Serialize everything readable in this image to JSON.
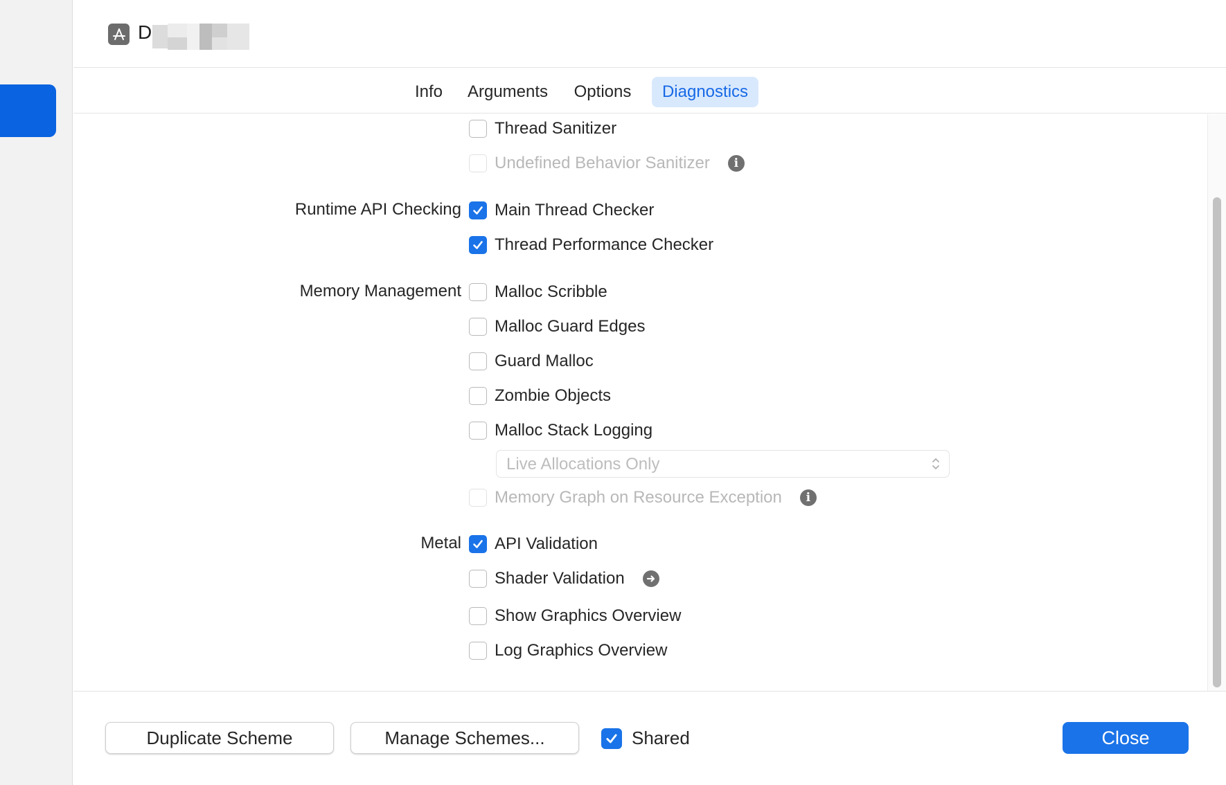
{
  "header": {
    "scheme_name": "D"
  },
  "tabs": [
    {
      "label": "Info",
      "active": false
    },
    {
      "label": "Arguments",
      "active": false
    },
    {
      "label": "Options",
      "active": false
    },
    {
      "label": "Diagnostics",
      "active": true
    }
  ],
  "diagnostics": {
    "sanitizers": [
      {
        "label": "Thread Sanitizer",
        "checked": false,
        "enabled": true
      },
      {
        "label": "Undefined Behavior Sanitizer",
        "checked": false,
        "enabled": false,
        "icon": "info-icon"
      }
    ],
    "runtime_api": {
      "section_label": "Runtime API Checking",
      "options": [
        {
          "label": "Main Thread Checker",
          "checked": true
        },
        {
          "label": "Thread Performance Checker",
          "checked": true
        }
      ]
    },
    "memory": {
      "section_label": "Memory Management",
      "options": [
        {
          "label": "Malloc Scribble",
          "checked": false
        },
        {
          "label": "Malloc Guard Edges",
          "checked": false
        },
        {
          "label": "Guard Malloc",
          "checked": false
        },
        {
          "label": "Zombie Objects",
          "checked": false
        },
        {
          "label": "Malloc Stack Logging",
          "checked": false
        }
      ],
      "stack_logging_popup": "Live Allocations Only",
      "memory_graph": {
        "label": "Memory Graph on Resource Exception",
        "checked": false,
        "enabled": false,
        "icon": "info-icon"
      }
    },
    "metal": {
      "section_label": "Metal",
      "options": [
        {
          "label": "API Validation",
          "checked": true
        },
        {
          "label": "Shader Validation",
          "checked": false,
          "icon": "arrow-right-icon"
        },
        {
          "label": "Show Graphics Overview",
          "checked": false
        },
        {
          "label": "Log Graphics Overview",
          "checked": false
        }
      ]
    }
  },
  "footer": {
    "duplicate_label": "Duplicate Scheme",
    "manage_label": "Manage Schemes...",
    "shared_label": "Shared",
    "shared_checked": true,
    "close_label": "Close"
  },
  "colors": {
    "accent": "#1a73e8",
    "tab_active_bg": "#d9e9fd",
    "sidebar_selection": "#0a63e0"
  }
}
